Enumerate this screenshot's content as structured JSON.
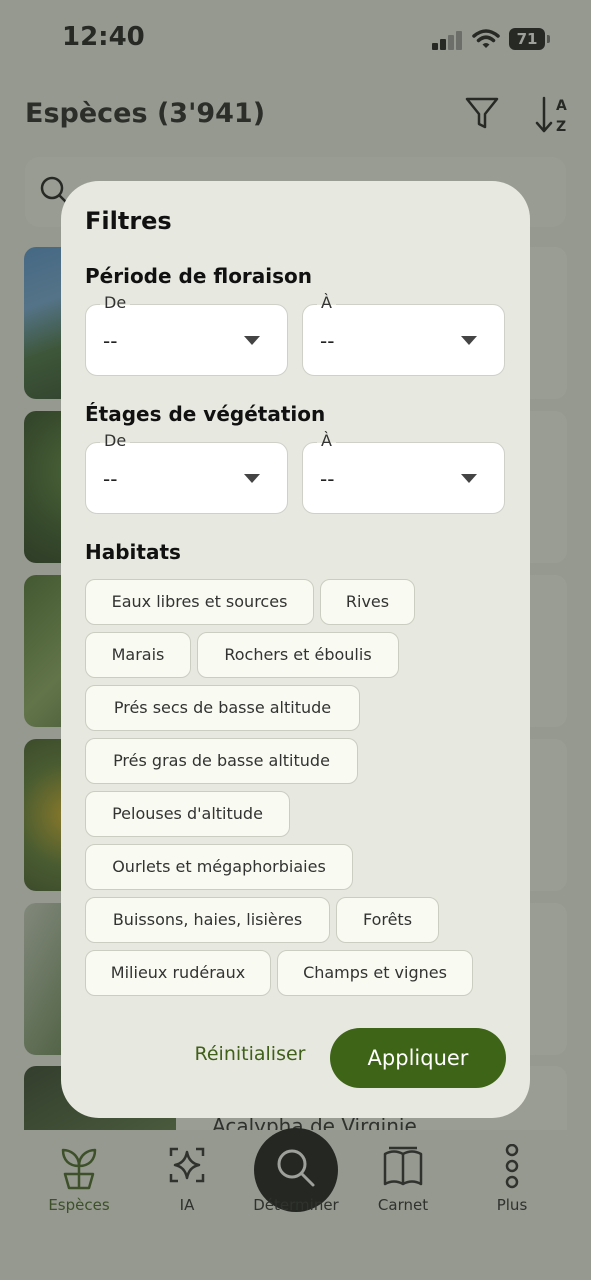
{
  "status_bar": {
    "time": "12:40",
    "battery": "71"
  },
  "header": {
    "title": "Espèces (3'941)",
    "filter_icon": "filter-icon",
    "sort_icon": "sort-az-icon"
  },
  "search": {
    "icon": "search-icon"
  },
  "list": {
    "partial_species_name": "Acalypha de Virginie"
  },
  "filter_modal": {
    "title": "Filtres",
    "flowering": {
      "title": "Période de floraison",
      "from": {
        "label": "De",
        "value": "--"
      },
      "to": {
        "label": "À",
        "value": "--"
      }
    },
    "vegetation": {
      "title": "Étages de végétation",
      "from": {
        "label": "De",
        "value": "--"
      },
      "to": {
        "label": "À",
        "value": "--"
      }
    },
    "habitats": {
      "title": "Habitats",
      "chips": [
        "Eaux libres et sources",
        "Rives",
        "Marais",
        "Rochers et éboulis",
        "Prés secs de basse altitude",
        "Prés gras de basse altitude",
        "Pelouses d'altitude",
        "Ourlets et mégaphorbiaies",
        "Buissons, haies, lisières",
        "Forêts",
        "Milieux rudéraux",
        "Champs et vignes"
      ]
    },
    "reset_label": "Réinitialiser",
    "apply_label": "Appliquer"
  },
  "bottom_nav": {
    "items": [
      {
        "label": "Espèces",
        "icon": "plant-sprout-icon",
        "active": true
      },
      {
        "label": "IA",
        "icon": "ai-sparkle-icon",
        "active": false
      },
      {
        "label": "Déterminer",
        "icon": "search-icon",
        "active": false
      },
      {
        "label": "Carnet",
        "icon": "book-icon",
        "active": false
      },
      {
        "label": "Plus",
        "icon": "more-dots-icon",
        "active": false
      }
    ]
  },
  "colors": {
    "accent": "#3e6517",
    "modal_bg": "#e7e8df",
    "chip_bg": "#f9faf1"
  }
}
